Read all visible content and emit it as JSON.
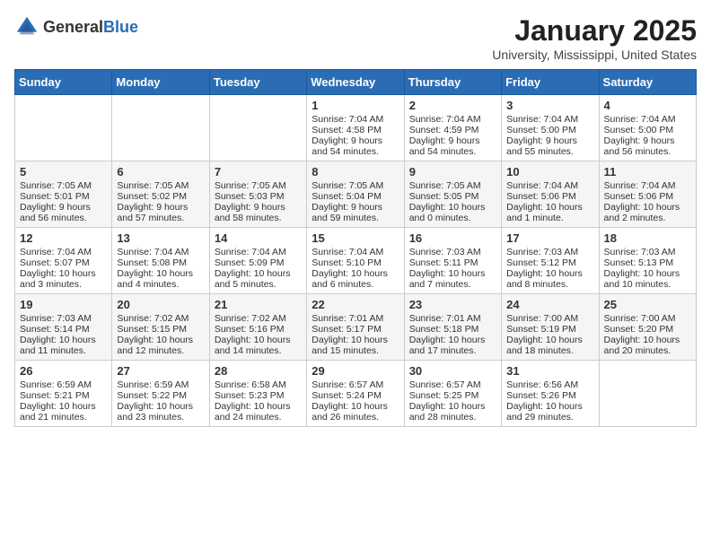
{
  "header": {
    "logo_general": "General",
    "logo_blue": "Blue",
    "title": "January 2025",
    "subtitle": "University, Mississippi, United States"
  },
  "days_of_week": [
    "Sunday",
    "Monday",
    "Tuesday",
    "Wednesday",
    "Thursday",
    "Friday",
    "Saturday"
  ],
  "weeks": [
    [
      {
        "day": "",
        "sunrise": "",
        "sunset": "",
        "daylight": ""
      },
      {
        "day": "",
        "sunrise": "",
        "sunset": "",
        "daylight": ""
      },
      {
        "day": "",
        "sunrise": "",
        "sunset": "",
        "daylight": ""
      },
      {
        "day": "1",
        "sunrise": "Sunrise: 7:04 AM",
        "sunset": "Sunset: 4:58 PM",
        "daylight": "Daylight: 9 hours and 54 minutes."
      },
      {
        "day": "2",
        "sunrise": "Sunrise: 7:04 AM",
        "sunset": "Sunset: 4:59 PM",
        "daylight": "Daylight: 9 hours and 54 minutes."
      },
      {
        "day": "3",
        "sunrise": "Sunrise: 7:04 AM",
        "sunset": "Sunset: 5:00 PM",
        "daylight": "Daylight: 9 hours and 55 minutes."
      },
      {
        "day": "4",
        "sunrise": "Sunrise: 7:04 AM",
        "sunset": "Sunset: 5:00 PM",
        "daylight": "Daylight: 9 hours and 56 minutes."
      }
    ],
    [
      {
        "day": "5",
        "sunrise": "Sunrise: 7:05 AM",
        "sunset": "Sunset: 5:01 PM",
        "daylight": "Daylight: 9 hours and 56 minutes."
      },
      {
        "day": "6",
        "sunrise": "Sunrise: 7:05 AM",
        "sunset": "Sunset: 5:02 PM",
        "daylight": "Daylight: 9 hours and 57 minutes."
      },
      {
        "day": "7",
        "sunrise": "Sunrise: 7:05 AM",
        "sunset": "Sunset: 5:03 PM",
        "daylight": "Daylight: 9 hours and 58 minutes."
      },
      {
        "day": "8",
        "sunrise": "Sunrise: 7:05 AM",
        "sunset": "Sunset: 5:04 PM",
        "daylight": "Daylight: 9 hours and 59 minutes."
      },
      {
        "day": "9",
        "sunrise": "Sunrise: 7:05 AM",
        "sunset": "Sunset: 5:05 PM",
        "daylight": "Daylight: 10 hours and 0 minutes."
      },
      {
        "day": "10",
        "sunrise": "Sunrise: 7:04 AM",
        "sunset": "Sunset: 5:06 PM",
        "daylight": "Daylight: 10 hours and 1 minute."
      },
      {
        "day": "11",
        "sunrise": "Sunrise: 7:04 AM",
        "sunset": "Sunset: 5:06 PM",
        "daylight": "Daylight: 10 hours and 2 minutes."
      }
    ],
    [
      {
        "day": "12",
        "sunrise": "Sunrise: 7:04 AM",
        "sunset": "Sunset: 5:07 PM",
        "daylight": "Daylight: 10 hours and 3 minutes."
      },
      {
        "day": "13",
        "sunrise": "Sunrise: 7:04 AM",
        "sunset": "Sunset: 5:08 PM",
        "daylight": "Daylight: 10 hours and 4 minutes."
      },
      {
        "day": "14",
        "sunrise": "Sunrise: 7:04 AM",
        "sunset": "Sunset: 5:09 PM",
        "daylight": "Daylight: 10 hours and 5 minutes."
      },
      {
        "day": "15",
        "sunrise": "Sunrise: 7:04 AM",
        "sunset": "Sunset: 5:10 PM",
        "daylight": "Daylight: 10 hours and 6 minutes."
      },
      {
        "day": "16",
        "sunrise": "Sunrise: 7:03 AM",
        "sunset": "Sunset: 5:11 PM",
        "daylight": "Daylight: 10 hours and 7 minutes."
      },
      {
        "day": "17",
        "sunrise": "Sunrise: 7:03 AM",
        "sunset": "Sunset: 5:12 PM",
        "daylight": "Daylight: 10 hours and 8 minutes."
      },
      {
        "day": "18",
        "sunrise": "Sunrise: 7:03 AM",
        "sunset": "Sunset: 5:13 PM",
        "daylight": "Daylight: 10 hours and 10 minutes."
      }
    ],
    [
      {
        "day": "19",
        "sunrise": "Sunrise: 7:03 AM",
        "sunset": "Sunset: 5:14 PM",
        "daylight": "Daylight: 10 hours and 11 minutes."
      },
      {
        "day": "20",
        "sunrise": "Sunrise: 7:02 AM",
        "sunset": "Sunset: 5:15 PM",
        "daylight": "Daylight: 10 hours and 12 minutes."
      },
      {
        "day": "21",
        "sunrise": "Sunrise: 7:02 AM",
        "sunset": "Sunset: 5:16 PM",
        "daylight": "Daylight: 10 hours and 14 minutes."
      },
      {
        "day": "22",
        "sunrise": "Sunrise: 7:01 AM",
        "sunset": "Sunset: 5:17 PM",
        "daylight": "Daylight: 10 hours and 15 minutes."
      },
      {
        "day": "23",
        "sunrise": "Sunrise: 7:01 AM",
        "sunset": "Sunset: 5:18 PM",
        "daylight": "Daylight: 10 hours and 17 minutes."
      },
      {
        "day": "24",
        "sunrise": "Sunrise: 7:00 AM",
        "sunset": "Sunset: 5:19 PM",
        "daylight": "Daylight: 10 hours and 18 minutes."
      },
      {
        "day": "25",
        "sunrise": "Sunrise: 7:00 AM",
        "sunset": "Sunset: 5:20 PM",
        "daylight": "Daylight: 10 hours and 20 minutes."
      }
    ],
    [
      {
        "day": "26",
        "sunrise": "Sunrise: 6:59 AM",
        "sunset": "Sunset: 5:21 PM",
        "daylight": "Daylight: 10 hours and 21 minutes."
      },
      {
        "day": "27",
        "sunrise": "Sunrise: 6:59 AM",
        "sunset": "Sunset: 5:22 PM",
        "daylight": "Daylight: 10 hours and 23 minutes."
      },
      {
        "day": "28",
        "sunrise": "Sunrise: 6:58 AM",
        "sunset": "Sunset: 5:23 PM",
        "daylight": "Daylight: 10 hours and 24 minutes."
      },
      {
        "day": "29",
        "sunrise": "Sunrise: 6:57 AM",
        "sunset": "Sunset: 5:24 PM",
        "daylight": "Daylight: 10 hours and 26 minutes."
      },
      {
        "day": "30",
        "sunrise": "Sunrise: 6:57 AM",
        "sunset": "Sunset: 5:25 PM",
        "daylight": "Daylight: 10 hours and 28 minutes."
      },
      {
        "day": "31",
        "sunrise": "Sunrise: 6:56 AM",
        "sunset": "Sunset: 5:26 PM",
        "daylight": "Daylight: 10 hours and 29 minutes."
      },
      {
        "day": "",
        "sunrise": "",
        "sunset": "",
        "daylight": ""
      }
    ]
  ]
}
